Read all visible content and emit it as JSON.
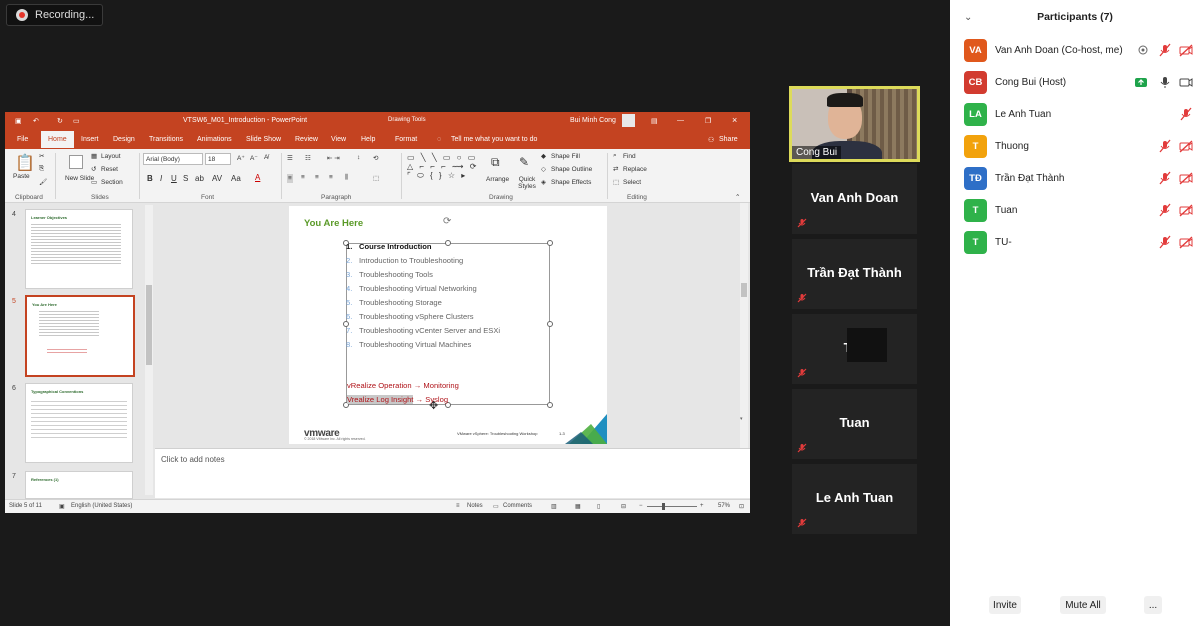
{
  "recording": {
    "label": "Recording..."
  },
  "powerpoint": {
    "file_title": "VTSW6_M01_Introduction  -  PowerPoint",
    "context_tab": "Drawing Tools",
    "user": "Bui Minh Cong",
    "tabs": [
      "File",
      "Home",
      "Insert",
      "Design",
      "Transitions",
      "Animations",
      "Slide Show",
      "Review",
      "View",
      "Help",
      "Format"
    ],
    "tell_me": "Tell me what you want to do",
    "share": "Share",
    "ribbon": {
      "paste": "Paste",
      "new_slide": "New Slide",
      "layout": "Layout",
      "reset": "Reset",
      "section": "Section",
      "font_name": "Arial (Body)",
      "font_size": "18",
      "arrange": "Arrange",
      "quick_styles": "Quick Styles",
      "shape_fill": "Shape Fill",
      "shape_outline": "Shape Outline",
      "shape_effects": "Shape Effects",
      "find": "Find",
      "replace": "Replace",
      "select": "Select",
      "groups": [
        "Clipboard",
        "Slides",
        "Font",
        "Paragraph",
        "Drawing",
        "Editing"
      ]
    },
    "thumb_numbers": [
      "4",
      "5",
      "6",
      "7"
    ],
    "thumbnails": {
      "t4_title": "Learner Objectives",
      "t5_title": "You Are Here",
      "t6_title": "Typographical Conventions",
      "t7_title": "References (1)"
    },
    "slide": {
      "title": "You Are Here",
      "items": [
        "Course Introduction",
        "Introduction to Troubleshooting",
        "Troubleshooting Tools",
        "Troubleshooting Virtual Networking",
        "Troubleshooting Storage",
        "Troubleshooting vSphere Clusters",
        "Troubleshooting vCenter Server and ESXi",
        "Troubleshooting Virtual Machines"
      ],
      "numbers": [
        "1.",
        "2.",
        "3.",
        "4.",
        "5.",
        "6.",
        "7.",
        "8."
      ],
      "extra1": "vRealize Operation → Monitoring",
      "extra2_a": "Vrealize Log Insight",
      "extra2_b": "→ Syslog",
      "logo": "vmware",
      "copyright": "© 2018 VMware Inc. All rights reserved.",
      "footer": "VMware vSphere: Troubleshooting Workshop",
      "page": "1-3"
    },
    "notes_placeholder": "Click to add notes",
    "status": {
      "slide_count": "Slide 5 of 11",
      "language": "English (United States)",
      "notes": "Notes",
      "comments": "Comments",
      "zoom": "57%"
    }
  },
  "video": {
    "active_speaker": "Cong Bui",
    "tiles": [
      "Van Anh Doan",
      "Trần Đạt Thành",
      "TU-",
      "Tuan",
      "Le Anh Tuan"
    ]
  },
  "participants": {
    "title": "Participants (7)",
    "list": [
      {
        "initials": "VA",
        "name": "Van Anh Doan (Co-host, me)",
        "color": "#e0581c"
      },
      {
        "initials": "CB",
        "name": "Cong Bui (Host)",
        "color": "#d23b2f"
      },
      {
        "initials": "LA",
        "name": "Le Anh Tuan",
        "color": "#2fb24a"
      },
      {
        "initials": "T",
        "name": "Thuong",
        "color": "#f2a20c"
      },
      {
        "initials": "TĐ",
        "name": "Trần Đạt Thành",
        "color": "#2e6fc7"
      },
      {
        "initials": "T",
        "name": "Tuan",
        "color": "#2fb24a"
      },
      {
        "initials": "T",
        "name": "TU-",
        "color": "#2fb24a"
      }
    ],
    "invite": "Invite",
    "mute_all": "Mute All",
    "more": "..."
  }
}
